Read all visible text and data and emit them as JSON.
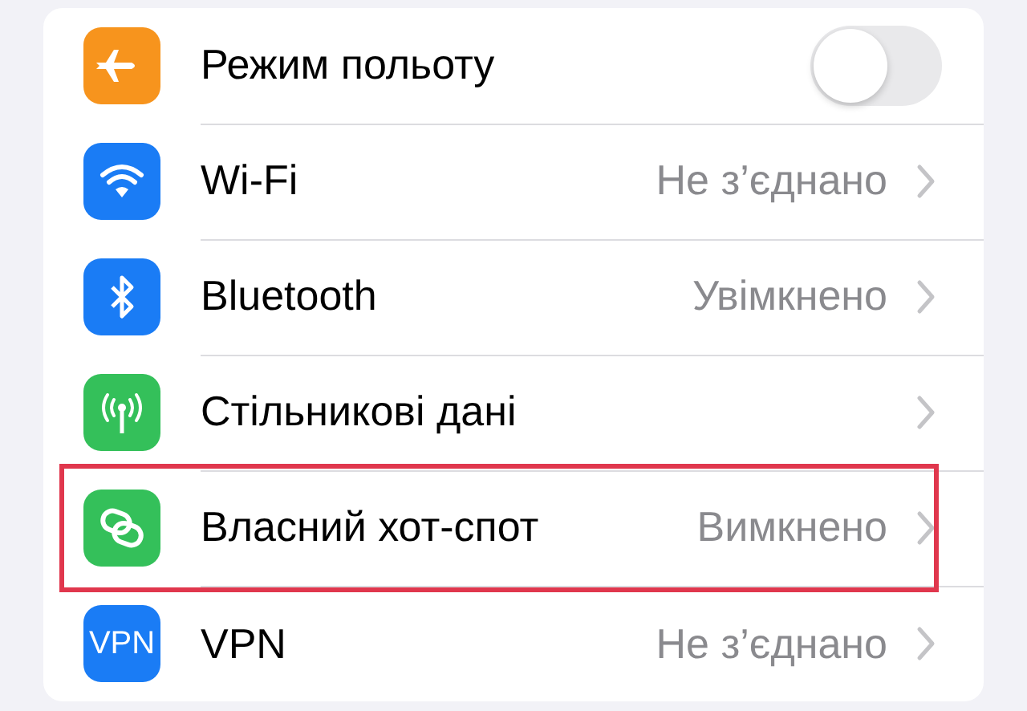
{
  "rows": [
    {
      "kind": "toggle",
      "label": "Режим польоту",
      "on": false,
      "color": "#f7941d",
      "highlighted": false
    },
    {
      "kind": "link",
      "label": "Wi-Fi",
      "value": "Не з’єднано",
      "color": "#1a7cf5",
      "highlighted": false
    },
    {
      "kind": "link",
      "label": "Bluetooth",
      "value": "Увімкнено",
      "color": "#1a7cf5",
      "highlighted": false
    },
    {
      "kind": "link",
      "label": "Стільникові дані",
      "color": "#34c05a",
      "highlighted": false
    },
    {
      "kind": "link",
      "label": "Власний хот-спот",
      "value": "Вимкнено",
      "color": "#34c05a",
      "highlighted": true
    },
    {
      "kind": "link",
      "label": "VPN",
      "value": "Не з’єднано",
      "color": "#1a7cf5",
      "icon_text": "VPN",
      "highlighted": false
    }
  ]
}
